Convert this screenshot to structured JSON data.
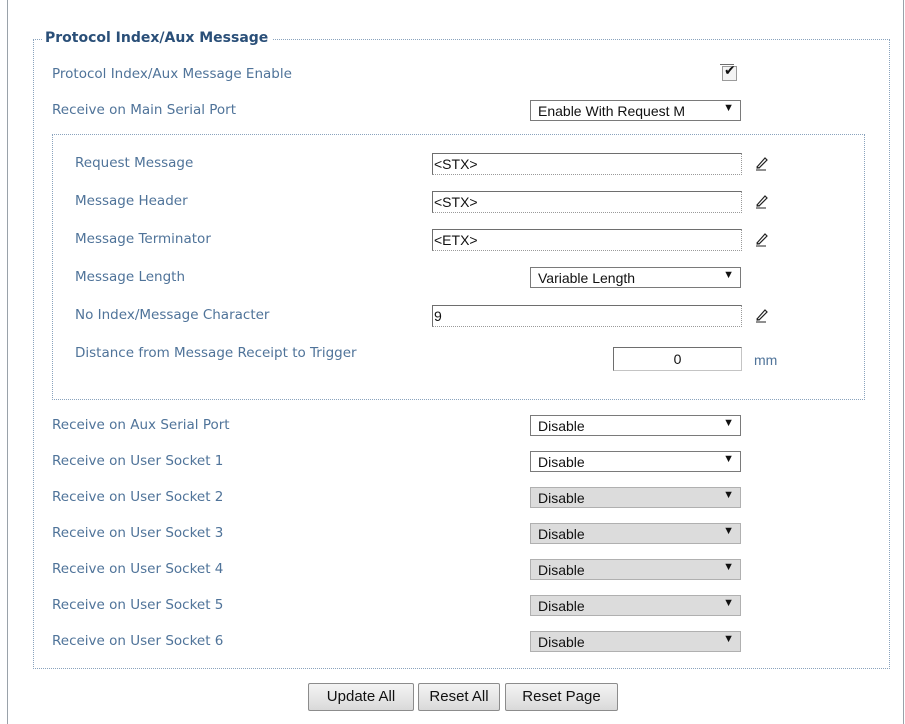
{
  "section": {
    "title": "Protocol Index/Aux Message",
    "enable_label": "Protocol Index/Aux Message Enable",
    "enable_checked": true,
    "main_serial_label": "Receive on Main Serial Port",
    "main_serial_value": "Enable With Request M"
  },
  "subsection": {
    "request_label": "Request Message",
    "request_value": "<STX>",
    "header_label": "Message Header",
    "header_value": "<STX>",
    "terminator_label": "Message Terminator",
    "terminator_value": "<ETX>",
    "length_label": "Message Length",
    "length_value": "Variable Length",
    "no_index_label": "No Index/Message Character",
    "no_index_value": "9",
    "distance_label": "Distance from Message Receipt to Trigger",
    "distance_value": "0",
    "distance_unit": "mm"
  },
  "ports": [
    {
      "label": "Receive on Aux Serial Port",
      "value": "Disable",
      "enabled": true
    },
    {
      "label": "Receive on User Socket 1",
      "value": "Disable",
      "enabled": true
    },
    {
      "label": "Receive on User Socket 2",
      "value": "Disable",
      "enabled": false
    },
    {
      "label": "Receive on User Socket 3",
      "value": "Disable",
      "enabled": false
    },
    {
      "label": "Receive on User Socket 4",
      "value": "Disable",
      "enabled": false
    },
    {
      "label": "Receive on User Socket 5",
      "value": "Disable",
      "enabled": false
    },
    {
      "label": "Receive on User Socket 6",
      "value": "Disable",
      "enabled": false
    }
  ],
  "buttons": {
    "update_all": "Update All",
    "reset_all": "Reset All",
    "reset_page": "Reset Page"
  },
  "icons": {
    "edit": "pencil-icon",
    "dropdown": "triangle-down"
  }
}
